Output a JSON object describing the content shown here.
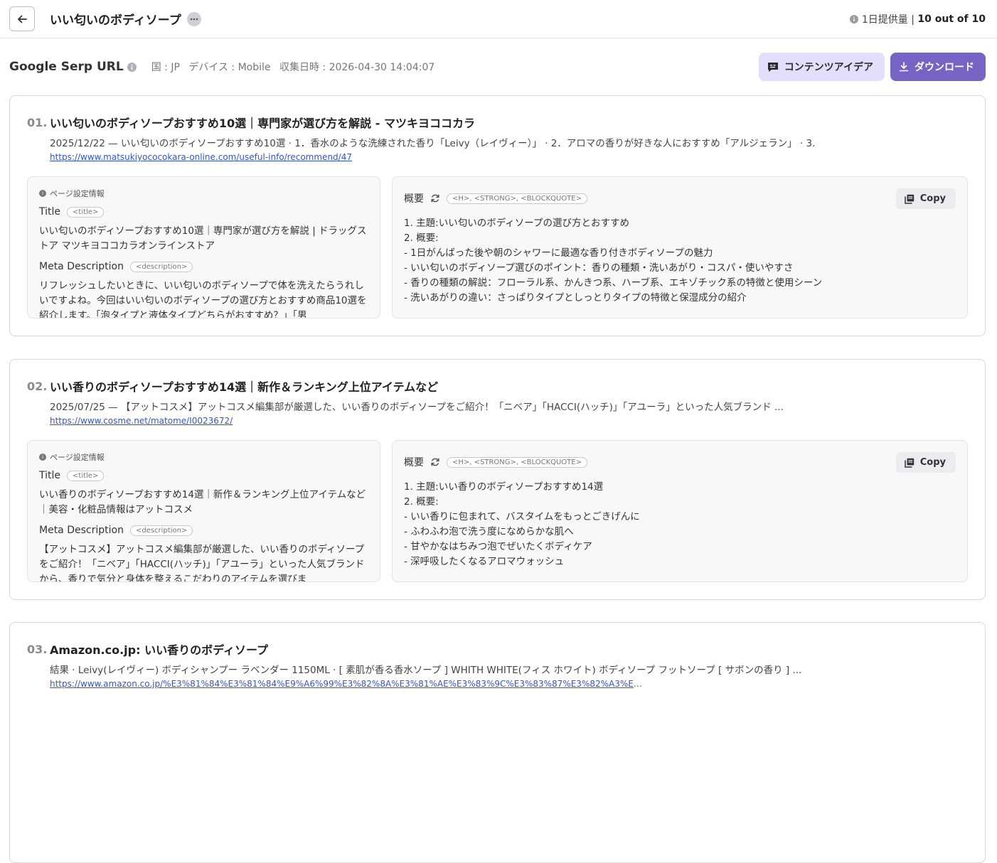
{
  "header": {
    "title": "いい匂いのボディソープ",
    "quota_label": "1日提供量 |",
    "quota_value": "10 out of 10"
  },
  "serp": {
    "title": "Google Serp URL",
    "country": "国 : JP",
    "device": "デバイス : Mobile",
    "collected": "収集日時 : 2026-04-30 14:04:07",
    "idea_button": "コンテンツアイデア",
    "download_button": "ダウンロード"
  },
  "labels": {
    "page_info": "ページ設定情報",
    "title": "Title",
    "title_tag": "<title>",
    "meta": "Meta Description",
    "meta_tag": "<description>",
    "summary": "概要",
    "summary_tags": "<H>, <STRONG>, <BLOCKQUOTE>",
    "copy": "Copy"
  },
  "results": [
    {
      "rank": "01.",
      "title": "いい匂いのボディソープおすすめ10選｜専門家が選び方を解説 - マツキヨココカラ",
      "snippet": "2025/12/22 — いい匂いのボディソープおすすめ10選 · 1．香水のような洗練された香り「Leivy（レイヴィー）」 · 2．アロマの香りが好きな人におすすめ「アルジェラン」 · 3.",
      "url": "https://www.matsukiyococokara-online.com/useful-info/recommend/47",
      "page_title": "いい匂いのボディソープおすすめ10選｜専門家が選び方を解説 | ドラッグストア マツキヨココカラオンラインストア",
      "meta_description": "リフレッシュしたいときに、いい匂いのボディソープで体を洗えたらうれしいですよね。今回はいい匂いのボディソープの選び方とおすすめ商品10選を紹介します。「泡タイプと液体タイプどちらがおすすめ？」「男",
      "summary": [
        "1. 主題:いい匂いのボディソープの選び方とおすすめ",
        "2. 概要:",
        "- 1日がんばった後や朝のシャワーに最適な香り付きボディソープの魅力",
        "- いい匂いのボディソープ選びのポイント：香りの種類・洗いあがり・コスパ・使いやすさ",
        "- 香りの種類の解説：フローラル系、かんきつ系、ハーブ系、エキゾチック系の特徴と使用シーン",
        "- 洗いあがりの違い：さっぱりタイプとしっとりタイプの特徴と保湿成分の紹介"
      ]
    },
    {
      "rank": "02.",
      "title": "いい香りのボディソープおすすめ14選｜新作＆ランキング上位アイテムなど",
      "snippet": "2025/07/25 — 【アットコスメ】アットコスメ編集部が厳選した、いい香りのボディソープをご紹介！「ニベア」「HACCI(ハッチ)」「アユーラ」といった人気ブランド ...",
      "url": "https://www.cosme.net/matome/I0023672/",
      "page_title": "いい香りのボディソープおすすめ14選｜新作＆ランキング上位アイテムなど｜美容・化粧品情報はアットコスメ",
      "meta_description": "【アットコスメ】アットコスメ編集部が厳選した、いい香りのボディソープをご紹介！「ニベア」「HACCI(ハッチ)」「アユーラ」といった人気ブランドから、香りで気分と身体を整えるこだわりのアイテムを選びま",
      "summary": [
        "1. 主題:いい香りのボディソープおすすめ14選",
        "2. 概要:",
        "- いい香りに包まれて、バスタイムをもっとごきげんに",
        "- ふわふわ泡で洗う度になめらかな肌へ",
        "- 甘やかなはちみつ泡でぜいたくボディケア",
        "- 深呼吸したくなるアロマウォッシュ"
      ]
    },
    {
      "rank": "03.",
      "title": "Amazon.co.jp: いい香りのボディソープ",
      "snippet": "結果 · Leivy(レイヴィー) ボディシャンプー ラベンダー 1150ML · [ 素肌が香る香水ソープ ] WHITH WHITE(フィス ホワイト) ボディソープ フットソープ [ サボンの香り ] ...",
      "url": "https://www.amazon.co.jp/%E3%81%84%E3%81%84%E9%A6%99%E3%82%8A%E3%81%AE%E3%83%9C%E3%83%87%E3%82%A3%E3%82%BD…"
    }
  ]
}
